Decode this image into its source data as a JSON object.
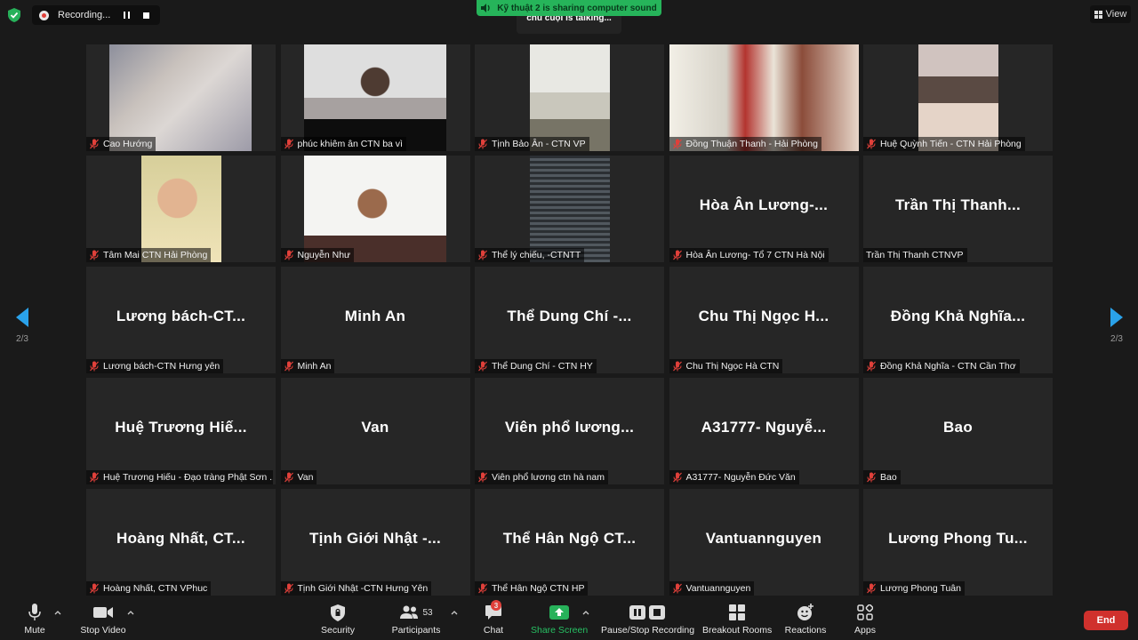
{
  "top": {
    "recording_label": "Recording...",
    "share_banner": "Kỹ thuật 2 is sharing computer sound",
    "talking_text": "chú cuội is talking...",
    "view_label": "View"
  },
  "pagination": {
    "left": "2/3",
    "right": "2/3"
  },
  "participants": [
    {
      "name": "",
      "label": "Cao Hướng"
    },
    {
      "name": "",
      "label": "phúc khiêm ân CTN ba vì"
    },
    {
      "name": "",
      "label": "Tịnh Bảo Ân - CTN VP"
    },
    {
      "name": "",
      "label": "Đồng Thuận Thanh - Hải Phòng"
    },
    {
      "name": "",
      "label": "Huệ Quỳnh Tiến - CTN Hải Phòng"
    },
    {
      "name": "",
      "label": "Tâm Mai CTN Hải Phòng"
    },
    {
      "name": "",
      "label": "Nguyễn Như"
    },
    {
      "name": "",
      "label": "Thể lý chiếu, -CTNTT"
    },
    {
      "name": "Hòa Ân Lương-...",
      "label": "Hòa Ân Lương- Tổ 7 CTN Hà Nội"
    },
    {
      "name": "Trần Thị Thanh...",
      "label": "Trần Thị Thanh CTNVP"
    },
    {
      "name": "Lương bách-CT...",
      "label": "Lương bách-CTN Hưng yên"
    },
    {
      "name": "Minh An",
      "label": "Minh An"
    },
    {
      "name": "Thể Dung Chí -...",
      "label": "Thể Dung Chí - CTN HY"
    },
    {
      "name": "Chu Thị Ngọc H...",
      "label": "Chu Thị Ngọc Hà CTN"
    },
    {
      "name": "Đồng Khả Nghĩa...",
      "label": "Đồng Khả Nghĩa - CTN Cần Thơ"
    },
    {
      "name": "Huệ Trương Hiế...",
      "label": "Huệ Trương Hiếu - Đạo tràng Phật Sơn ..."
    },
    {
      "name": "Van",
      "label": "Van"
    },
    {
      "name": "Viên phổ lương...",
      "label": "Viên phổ lương ctn hà nam"
    },
    {
      "name": "A31777- Nguyễ...",
      "label": "A31777- Nguyễn Đức Văn"
    },
    {
      "name": "Bao",
      "label": "Bao"
    },
    {
      "name": "Hoàng Nhất, CT...",
      "label": "Hoàng Nhất, CTN VPhuc"
    },
    {
      "name": "Tịnh Giới Nhật -...",
      "label": "Tịnh Giới Nhật -CTN Hưng Yên"
    },
    {
      "name": "Thể Hân Ngộ CT...",
      "label": "Thể Hân Ngộ CTN HP"
    },
    {
      "name": "Vantuannguyen",
      "label": "Vantuannguyen"
    },
    {
      "name": "Lương Phong Tu...",
      "label": "Lương Phong Tuân"
    }
  ],
  "toolbar": {
    "mute": "Mute",
    "stop_video": "Stop Video",
    "security": "Security",
    "participants": "Participants",
    "participants_count": "53",
    "chat": "Chat",
    "chat_badge": "3",
    "share_screen": "Share Screen",
    "recording": "Pause/Stop Recording",
    "breakout": "Breakout Rooms",
    "reactions": "Reactions",
    "apps": "Apps",
    "end": "End"
  },
  "colors": {
    "share_green": "#26b45a",
    "end_red": "#d0312d",
    "nav_blue": "#2aa2ea",
    "muted_red": "#e0403a"
  }
}
